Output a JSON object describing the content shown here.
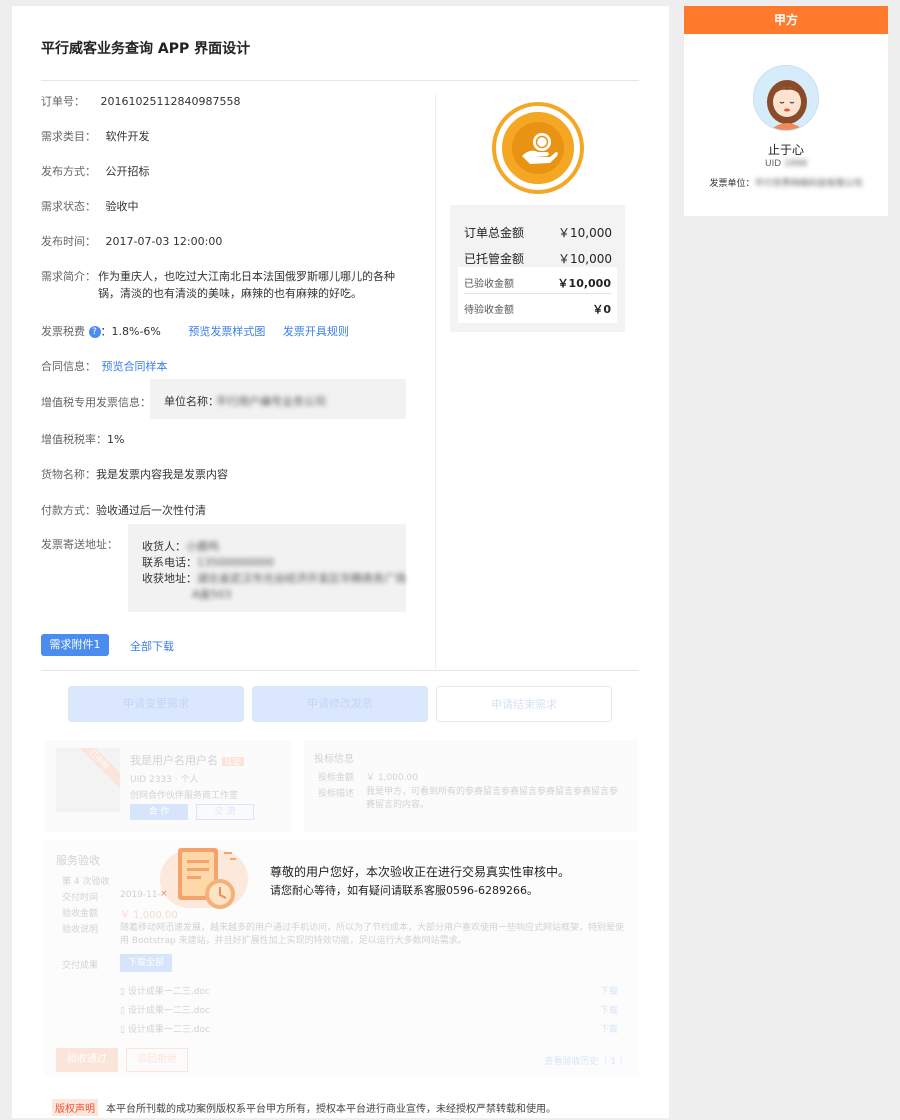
{
  "page": {
    "title": "平行威客业务查询 APP 界面设计"
  },
  "order": {
    "order_no_label": "订单号：",
    "order_no": "20161025112840987558",
    "category_label": "需求类目：",
    "category": "软件开发",
    "publish_label": "发布方式：",
    "publish": "公开招标",
    "status_label": "需求状态：",
    "status": "验收中",
    "time_label": "发布时间：",
    "time": "2017-07-03 12:00:00",
    "desc_label": "需求简介：",
    "desc": "作为重庆人，也吃过大江南北日本法国俄罗斯哪儿哪儿的各种锅，清淡的也有清淡的美味，麻辣的也有麻辣的好吃。",
    "tax_label": "发票税费",
    "tax_q": "?",
    "tax_value": "：1.8%-6%",
    "tax_preview_link": "预览发票样式图",
    "tax_rule_link": "发票开具规则",
    "contract_label": "合同信息：",
    "contract_link": "预览合同样本",
    "vat_label": "增值税专用发票信息：",
    "vat_unit_label": "单位名称：",
    "vat_unit_value": "平行用户编号业务公司",
    "vat_rate_label": "增值税税率：",
    "vat_rate": "1%",
    "goods_label": "货物名称：",
    "goods": "我是发票内容我是发票内容",
    "pay_label": "付款方式：",
    "pay": "验收通过后一次性付清",
    "addr_label": "发票寄送地址：",
    "receiver_label": "收货人：",
    "receiver": "小鹿鸣",
    "phone_label": "联系电话：",
    "phone": "13500000000",
    "address_label": "收获地址：",
    "address_line1": "湖北省武汉市光谷经济开发区华腾商务广场",
    "address_line2": "A座503",
    "attachment_button": "需求附件1",
    "download_all": "全部下载"
  },
  "amounts": {
    "total_label": "订单总金额",
    "total": "￥10,000",
    "escrow_label": "已托管金额",
    "escrow": "￥10,000",
    "accepted_label": "已验收金额",
    "accepted": "￥10,000",
    "pending_label": "待验收金额",
    "pending": "￥0"
  },
  "actions": {
    "change_request": "申请变更需求",
    "change_invoice": "申请修改发票",
    "end_request": "申请结束需求"
  },
  "faded": {
    "user_name": "我是用户名用户名",
    "user_badge": "认证",
    "user_uid": "UID 2333 · 个人",
    "user_team": "创网合作伙伴服务商工作室",
    "user_btn1": "合 作",
    "user_btn2": "交 流",
    "corner_tag": "已中标",
    "bid_title": "投标信息",
    "bid_amount_label": "投标金额",
    "bid_amount": "￥ 1,000.00",
    "bid_desc_label": "投标描述",
    "bid_desc": "我是甲方，可看到所有的参赛留言参赛留言参赛留言参赛留言参赛留言的内容。",
    "service_title": "服务验收",
    "round_label": "第 4 次验收",
    "submit_time_label": "交付时间",
    "submit_time": "2019-11-",
    "accept_amount_label": "验收金额",
    "accept_amount": "￥ 1,000.00",
    "accept_desc_label": "验收说明",
    "accept_desc": "随着移动网迅速发展，越来越多的用户通过手机访问，所以为了节约成本，大部分用户喜欢使用一些响应式网站框架，特别是使用 Bootstrap 来建站，并且好扩展性加上实现的特效功能，足以运行大多数网站需求。",
    "result_label": "交付成果",
    "result_download": "下载全部",
    "files": [
      "设计成果一二三.doc",
      "设计成果一二三.doc",
      "设计成果一二三.doc"
    ],
    "file_action": "下载",
    "btn_pass": "验收通过",
    "btn_reject": "驳回拒绝",
    "history_link": "查看验收历史（ 1 ）"
  },
  "overlay": {
    "line1": "尊敬的用户您好，本次验收正在进行交易真实性审核中。",
    "line2": "请您耐心等待，如有疑问请联系客服0596-6289266。"
  },
  "copyright": {
    "tag": "版权声明",
    "text": "本平台所刊载的成功案例版权系平台甲方所有，授权本平台进行商业宣传，未经授权严禁转载和使用。"
  },
  "side": {
    "header": "甲方",
    "name": "止于心",
    "uid_label": "UID",
    "uid": "1998",
    "unit_label": "发票单位：",
    "unit": "平行世界网络科技有限公司"
  },
  "colors": {
    "accent_orange": "#ff7a2c",
    "primary_blue": "#4a8cf0",
    "coin_gold": "#f5a623"
  }
}
